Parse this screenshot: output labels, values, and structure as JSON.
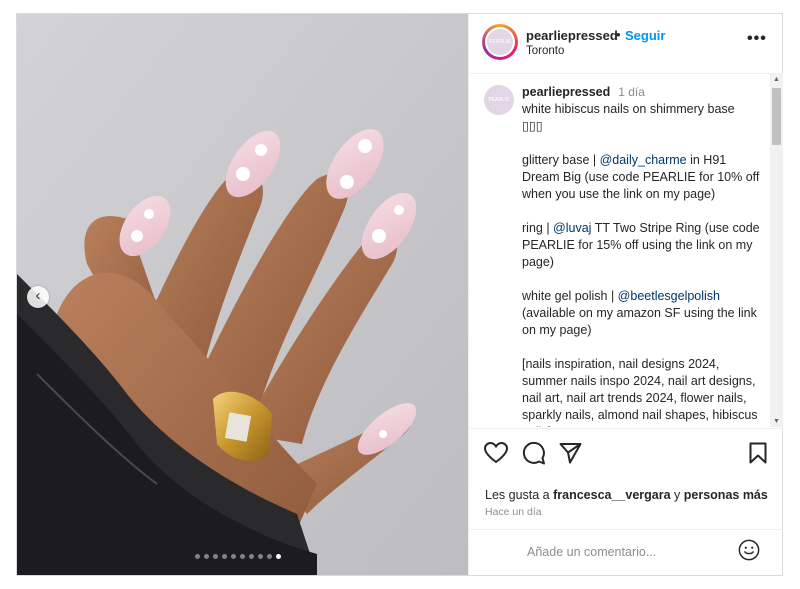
{
  "header": {
    "username": "pearliepressed",
    "separator": "•",
    "follow_label": "Seguir",
    "location": "Toronto",
    "more_label": "•••",
    "avatar_text": "PEARLIE"
  },
  "caption": {
    "username": "pearliepressed",
    "time": "1 día",
    "line1": "white hibiscus nails on shimmery base",
    "line2": "▯▯▯",
    "p2_a": "glittery base | ",
    "p2_mention": "@daily_charme",
    "p2_b": " in H91 Dream Big (use code PEARLIE for 10% off when you use the link on my page)",
    "p3_a": "ring | ",
    "p3_mention": "@luvaj",
    "p3_b": " TT Two Stripe Ring (use code PEARLIE for 15% off using the link on my page)",
    "p4_a": "white gel polish | ",
    "p4_mention": "@beetlesgelpolish",
    "p4_b": " (available on my amazon SF using the link on my page)",
    "p5": "[nails inspiration, nail designs 2024, summer nails inspo 2024, nail art designs, nail art, nail art trends 2024, flower nails, sparkly nails, almond nail",
    "p5_cut": "shapes, hibiscus nails]"
  },
  "carousel": {
    "prev_label": "‹",
    "slide_count": 10,
    "active_slide": 10
  },
  "likes": {
    "prefix": "Les gusta a ",
    "user": "francesca__vergara",
    "middle": " y ",
    "others": "personas más"
  },
  "posted": "Hace un día",
  "comment": {
    "placeholder": "Añade un comentario..."
  },
  "colors": {
    "follow": "#0095f6",
    "mention": "#00376b",
    "muted": "#8e8e8e"
  },
  "icons": [
    "heart-icon",
    "comment-icon",
    "share-icon",
    "bookmark-icon",
    "emoji-icon",
    "more-icon",
    "chevron-left-icon"
  ]
}
